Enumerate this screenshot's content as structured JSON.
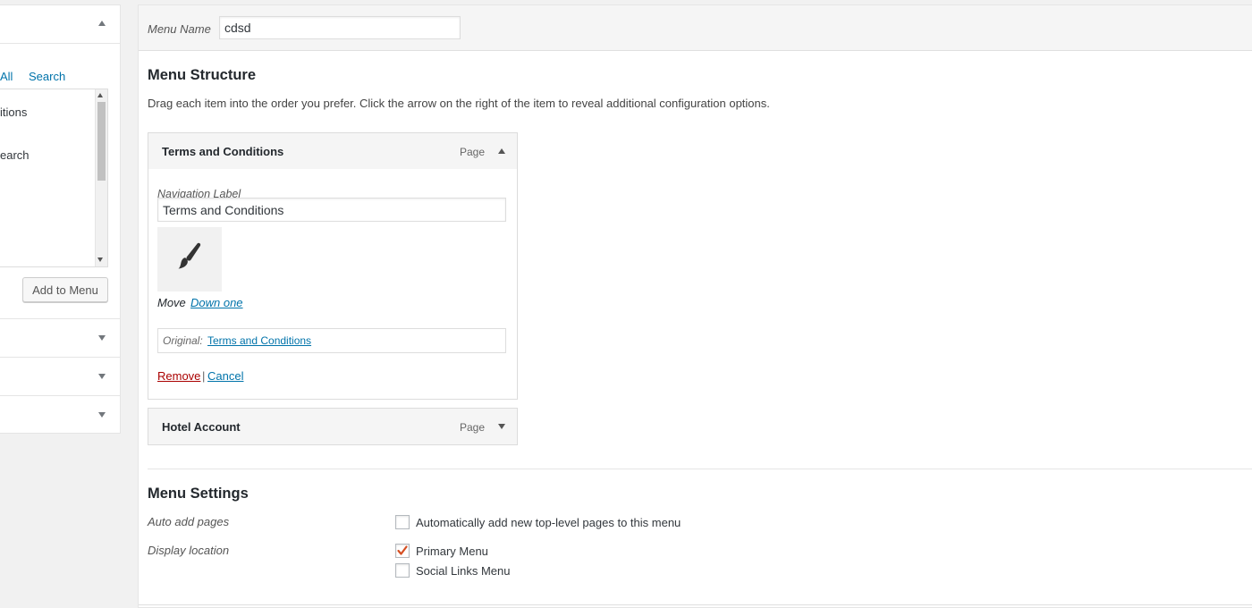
{
  "left_panel": {
    "tabs": [
      "All",
      "Search"
    ],
    "items": [
      "itions",
      "earch"
    ],
    "add_button": "Add to Menu",
    "collapse_icon": "triangle-up",
    "section_icons": [
      "triangle-down",
      "triangle-down",
      "triangle-down"
    ]
  },
  "header": {
    "menu_name_label": "Menu Name",
    "menu_name_value": "cdsd"
  },
  "structure": {
    "title": "Menu Structure",
    "description": "Drag each item into the order you prefer. Click the arrow on the right of the item to reveal additional configuration options.",
    "items": [
      {
        "title": "Terms and Conditions",
        "type": "Page",
        "expanded": true,
        "nav_label_caption": "Navigation Label",
        "nav_label_value": "Terms and Conditions",
        "icon": "paintbrush-icon",
        "move_label": "Move",
        "move_link": "Down one",
        "original_label": "Original:",
        "original_link": "Terms and Conditions",
        "remove_link": "Remove",
        "separator": "|",
        "cancel_link": "Cancel"
      },
      {
        "title": "Hotel Account",
        "type": "Page",
        "expanded": false
      }
    ]
  },
  "settings": {
    "title": "Menu Settings",
    "auto_add": {
      "label": "Auto add pages",
      "option": "Automatically add new top-level pages to this menu",
      "checked": false
    },
    "display_location": {
      "label": "Display location",
      "options": [
        {
          "label": "Primary Menu",
          "checked": true
        },
        {
          "label": "Social Links Menu",
          "checked": false
        }
      ]
    }
  },
  "colors": {
    "link": "#0073aa",
    "remove": "#a00",
    "check": "#d54e21"
  }
}
